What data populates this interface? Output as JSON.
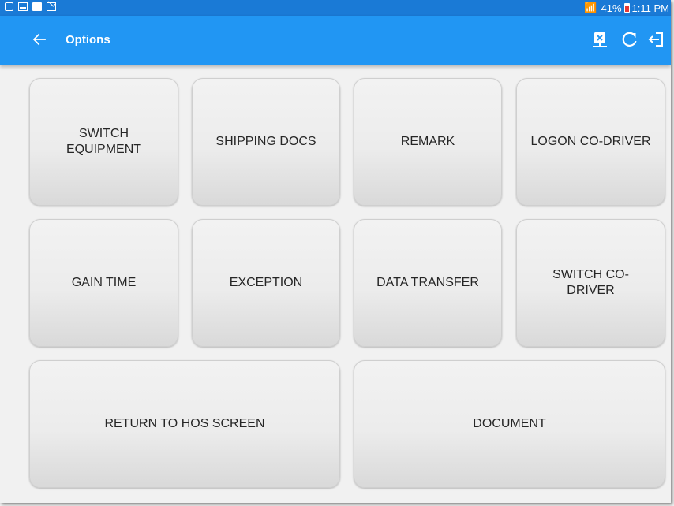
{
  "status_bar": {
    "battery_percent": "41%",
    "time": "1:11 PM",
    "notification_icons": [
      "cast-icon",
      "image-icon",
      "sms-icon",
      "gmail-icon"
    ]
  },
  "app_bar": {
    "title": "Options",
    "color": "#2196f3",
    "status_color": "#1a7ad6",
    "icons": [
      "back-arrow-icon",
      "data-transfer-icon",
      "refresh-icon",
      "logout-icon"
    ]
  },
  "buttons": {
    "switch_equipment": "SWITCH\nEQUIPMENT",
    "shipping_docs": "SHIPPING DOCS",
    "remark": "REMARK",
    "logon_co_driver": "LOGON CO-DRIVER",
    "gain_time": "GAIN TIME",
    "exception": "EXCEPTION",
    "data_transfer": "DATA TRANSFER",
    "switch_co_driver": "SWITCH CO-\nDRIVER",
    "return_to_hos": "RETURN TO HOS SCREEN",
    "document": "DOCUMENT"
  }
}
